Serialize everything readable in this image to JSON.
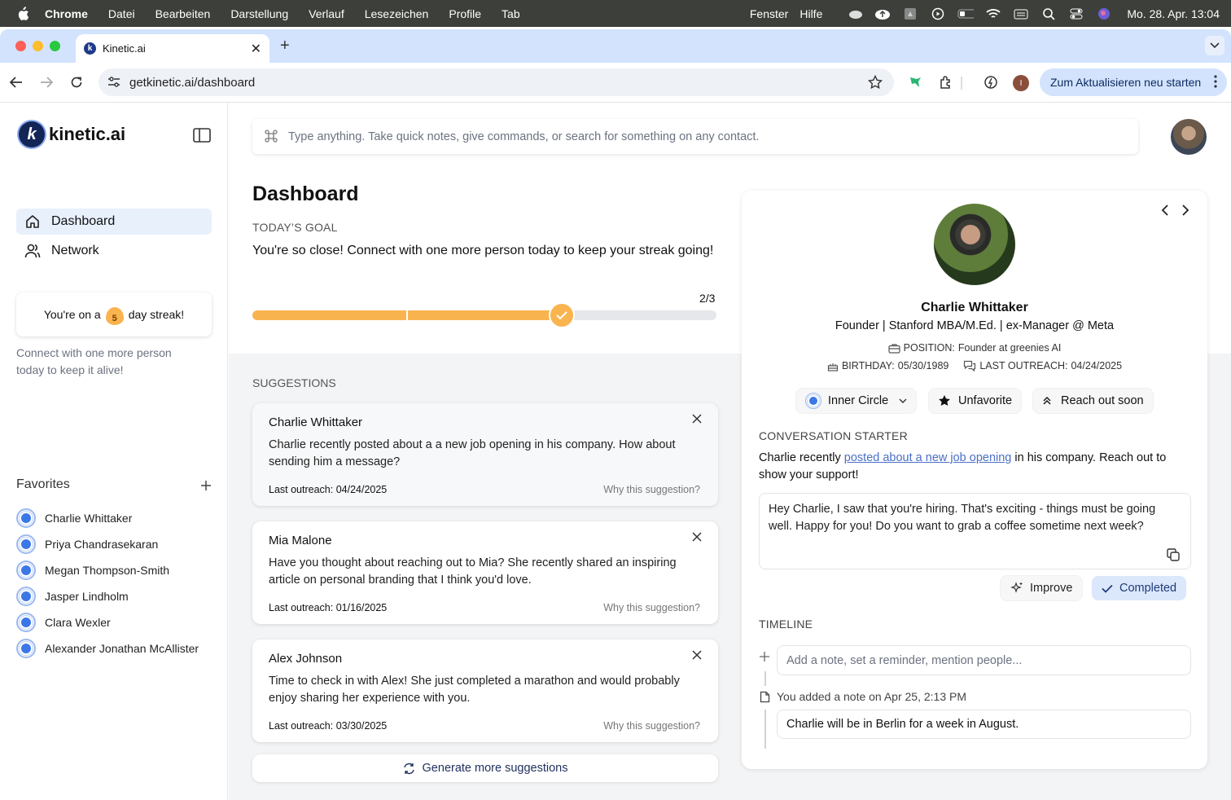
{
  "menubar": {
    "app": "Chrome",
    "items": [
      "Datei",
      "Bearbeiten",
      "Darstellung",
      "Verlauf",
      "Lesezeichen",
      "Profile",
      "Tab"
    ],
    "right_items": [
      "Fenster",
      "Hilfe"
    ],
    "clock": "Mo. 28. Apr.  13:04"
  },
  "browser": {
    "tab_title": "Kinetic.ai",
    "url": "getkinetic.ai/dashboard",
    "profile_initial": "I",
    "update_label": "Zum Aktualisieren neu starten"
  },
  "sidebar": {
    "logo_text": "kinetic.ai",
    "nav": [
      {
        "label": "Dashboard",
        "icon": "home-icon",
        "active": true
      },
      {
        "label": "Network",
        "icon": "users-icon",
        "active": false
      }
    ],
    "streak": {
      "prefix": "You're on a",
      "count": "5",
      "suffix": "day streak!"
    },
    "streak_sub": "Connect with one more person today to keep it alive!",
    "favorites_title": "Favorites",
    "favorites": [
      "Charlie Whittaker",
      "Priya Chandrasekaran",
      "Megan Thompson-Smith",
      "Jasper Lindholm",
      "Clara Wexler",
      "Alexander Jonathan McAllister"
    ]
  },
  "search": {
    "placeholder": "Type anything. Take quick notes, give commands, or search for something on any contact."
  },
  "dashboard": {
    "title": "Dashboard",
    "goal_label": "TODAY’S GOAL",
    "goal_text": "You're so close! Connect with one more person today to keep your streak going!",
    "progress_text": "2/3",
    "progress_fraction": 0.667,
    "suggestions_label": "SUGGESTIONS",
    "suggestions": [
      {
        "name": "Charlie Whittaker",
        "text": "Charlie recently posted about a a new job opening in his company. How about sending him a message?",
        "last": "Last outreach: 04/24/2025",
        "why": "Why this suggestion?"
      },
      {
        "name": "Mia Malone",
        "text": "Have you thought about reaching out to Mia? She recently shared an inspiring article on personal branding that I think you'd love.",
        "last": "Last outreach: 01/16/2025",
        "why": "Why this suggestion?"
      },
      {
        "name": "Alex Johnson",
        "text": "Time to check in with Alex! She just completed a marathon and would probably enjoy sharing her experience with you.",
        "last": "Last outreach: 03/30/2025",
        "why": "Why this suggestion?"
      }
    ],
    "generate_label": "Generate more suggestions"
  },
  "contact": {
    "name": "Charlie Whittaker",
    "headline": "Founder | Stanford MBA/M.Ed. | ex-Manager @ Meta",
    "position_label": "POSITION:",
    "position": "Founder at greenies AI",
    "birthday_label": "BIRTHDAY:",
    "birthday": "05/30/1989",
    "outreach_label": "LAST OUTREACH:",
    "outreach": "04/24/2025",
    "circle": "Inner Circle",
    "favorite_btn": "Unfavorite",
    "reach_btn": "Reach out soon",
    "starter_label": "CONVERSATION STARTER",
    "starter_pre": "Charlie recently",
    "starter_link": "posted about a new job opening",
    "starter_post": "in his company. Reach out to show your support!",
    "message": "Hey Charlie, I saw that you're hiring. That's exciting - things must be going well. Happy for you! Do you want to grab a coffee sometime next week?",
    "improve_btn": "Improve",
    "completed_btn": "Completed",
    "timeline_label": "TIMELINE",
    "timeline_placeholder": "Add a note, set a reminder, mention people...",
    "note_meta": "You added a note on Apr 25, 2:13 PM",
    "note_text": "Charlie will be in Berlin for a week in August."
  }
}
